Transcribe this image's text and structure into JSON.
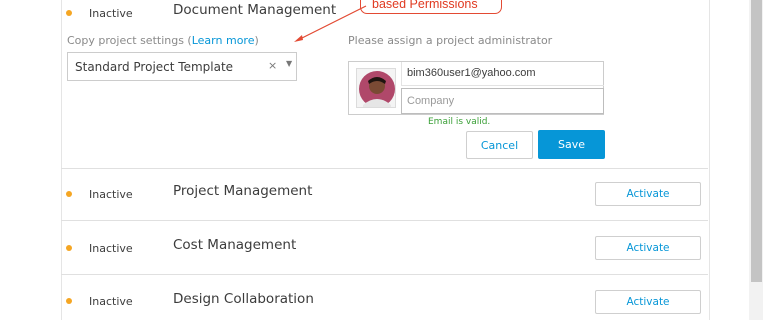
{
  "annotation": {
    "text": "based Permissions",
    "color": "#e03a21"
  },
  "expanded_service": {
    "status": "Inactive",
    "name": "Document Management",
    "copy_label_prefix": "Copy project settings (",
    "copy_label_link": "Learn more",
    "copy_label_suffix": ")",
    "template_value": "Standard Project Template",
    "clear_glyph": "×",
    "caret_glyph": "▼",
    "admin_label": "Please assign a project administrator",
    "admin_email": "bim360user1@yahoo.com",
    "company_placeholder": "Company",
    "validation_msg": "Email is valid.",
    "cancel_label": "Cancel",
    "save_label": "Save"
  },
  "services": [
    {
      "status": "Inactive",
      "name": "Project Management",
      "action": "Activate"
    },
    {
      "status": "Inactive",
      "name": "Cost Management",
      "action": "Activate"
    },
    {
      "status": "Inactive",
      "name": "Design Collaboration",
      "action": "Activate"
    }
  ],
  "colors": {
    "status_dot": "#f5a623",
    "accent": "#0696d7",
    "valid": "#3ba038"
  }
}
